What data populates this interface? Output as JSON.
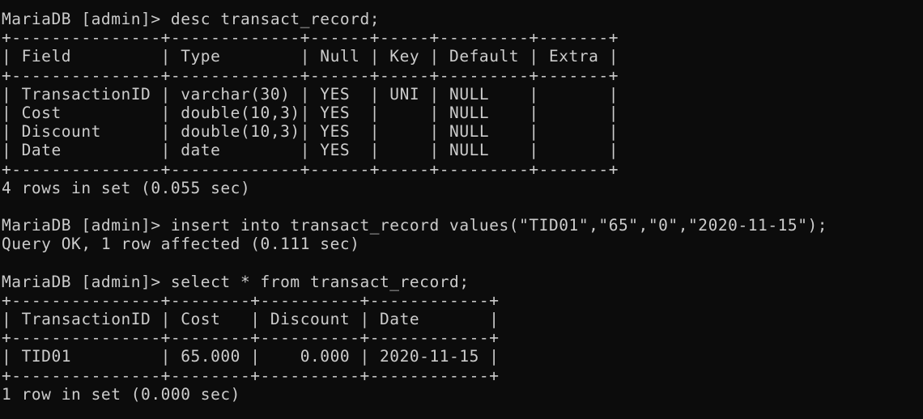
{
  "terminal": {
    "lines": [
      "MariaDB [admin]> desc transact_record;",
      "+---------------+-------------+------+-----+---------+-------+",
      "| Field         | Type        | Null | Key | Default | Extra |",
      "+---------------+-------------+------+-----+---------+-------+",
      "| TransactionID | varchar(30) | YES  | UNI | NULL    |       |",
      "| Cost          | double(10,3)| YES  |     | NULL    |       |",
      "| Discount      | double(10,3)| YES  |     | NULL    |       |",
      "| Date          | date        | YES  |     | NULL    |       |",
      "+---------------+-------------+------+-----+---------+-------+",
      "4 rows in set (0.055 sec)",
      "",
      "MariaDB [admin]> insert into transact_record values(\"TID01\",\"65\",\"0\",\"2020-11-15\");",
      "Query OK, 1 row affected (0.111 sec)",
      "",
      "MariaDB [admin]> select * from transact_record;",
      "+---------------+--------+----------+------------+",
      "| TransactionID | Cost   | Discount | Date       |",
      "+---------------+--------+----------+------------+",
      "| TID01         | 65.000 |    0.000 | 2020-11-15 |",
      "+---------------+--------+----------+------------+",
      "1 row in set (0.000 sec)"
    ]
  },
  "colors": {
    "background": "#0c0c0c",
    "foreground": "#cccccc"
  }
}
